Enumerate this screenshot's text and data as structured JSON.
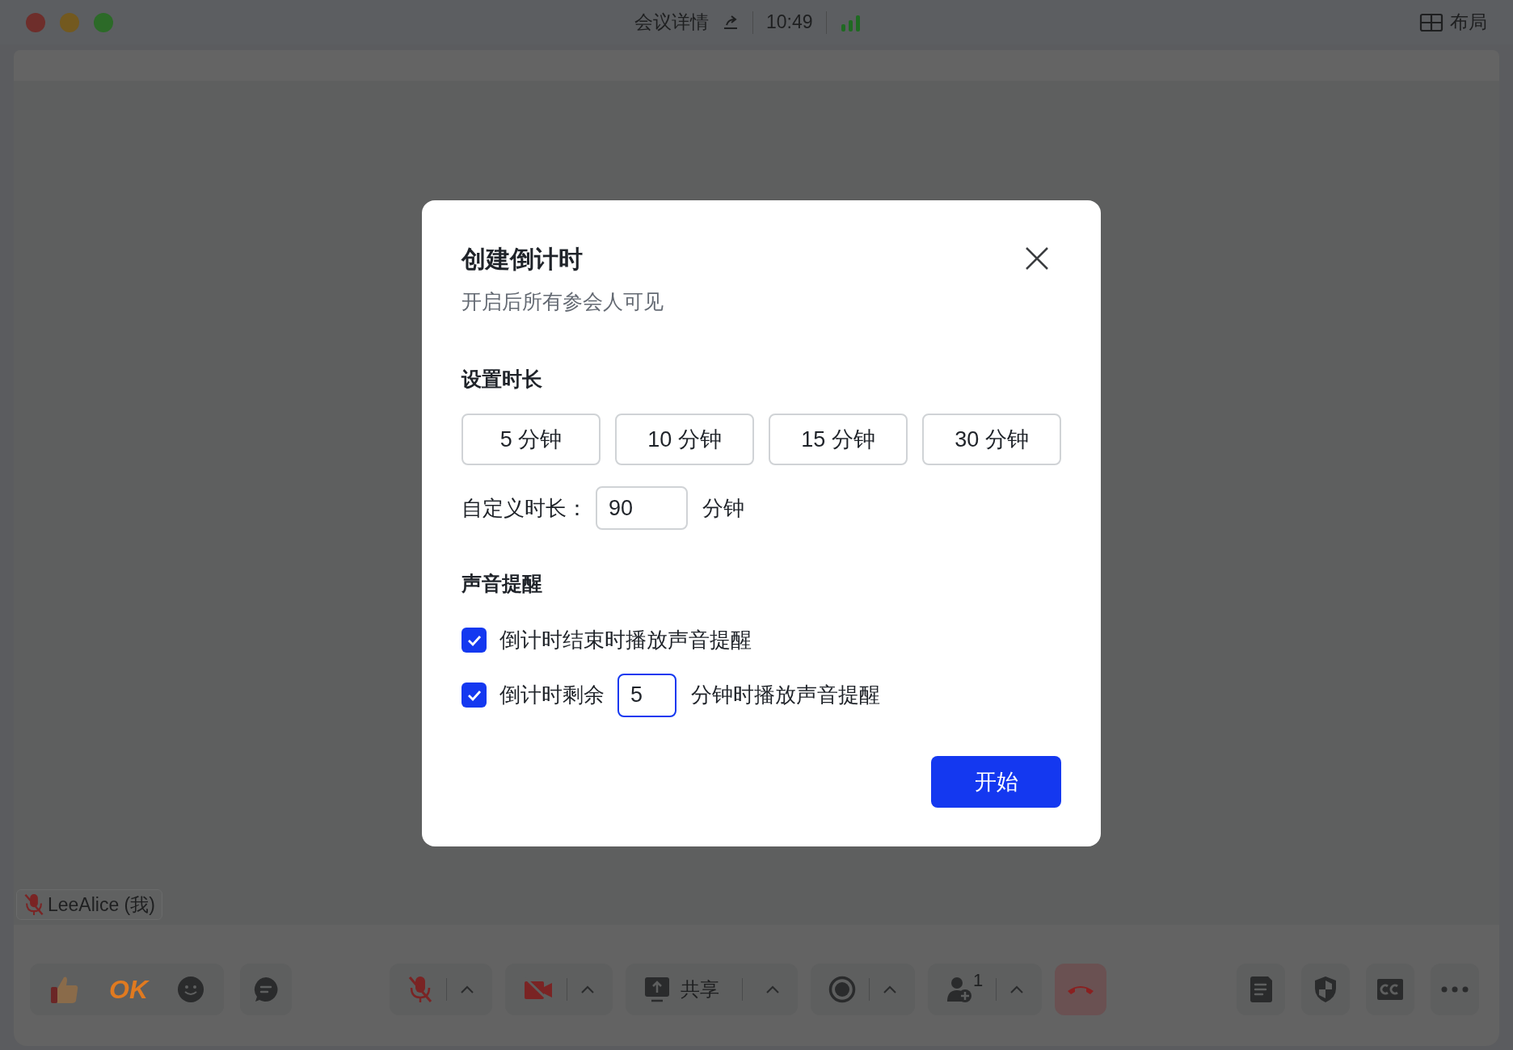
{
  "window": {
    "title": "会议详情",
    "time": "10:49",
    "layout_label": "布局"
  },
  "participant": {
    "name": "LeeAlice (我)",
    "muted": true
  },
  "toolbar": {
    "reaction_text": "OK",
    "mic_muted": true,
    "camera_off": true,
    "share_label": "共享",
    "participant_count": "1"
  },
  "dialog": {
    "title": "创建倒计时",
    "subtitle": "开启后所有参会人可见",
    "duration_heading": "设置时长",
    "presets": [
      {
        "label": "5 分钟",
        "selected": false
      },
      {
        "label": "10 分钟",
        "selected": false
      },
      {
        "label": "15 分钟",
        "selected": false
      },
      {
        "label": "30 分钟",
        "selected": false
      }
    ],
    "custom_label": "自定义时长：",
    "custom_value": "90",
    "custom_unit": "分钟",
    "sound_heading": "声音提醒",
    "reminders": [
      {
        "kind": "plain",
        "label": "倒计时结束时播放声音提醒",
        "checked": true
      },
      {
        "kind": "with_input",
        "label_before": "倒计时剩余",
        "value": "5",
        "label_after": "分钟时播放声音提醒",
        "checked": true,
        "focused": true
      }
    ],
    "start_button": "开始"
  }
}
